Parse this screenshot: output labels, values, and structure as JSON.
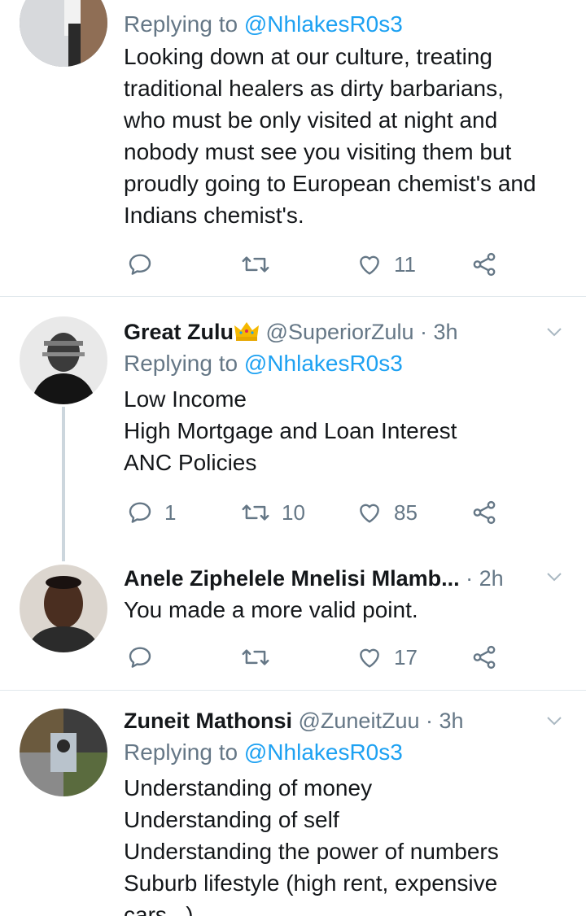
{
  "tweets": [
    {
      "reply_label": "Replying to",
      "reply_handle": "@NhlakesR0s3",
      "lines": [
        "Looking down at our culture, treating",
        "traditional healers as dirty barbarians,",
        "who must be only visited at night and",
        "nobody must see you visiting them but",
        "proudly going to European chemist's and",
        "Indians chemist's."
      ],
      "reply_count": "",
      "retweet_count": "",
      "like_count": "11"
    },
    {
      "name": "Great Zulu",
      "name_emoji": "👑",
      "handle": "@SuperiorZulu",
      "time": "· 3h",
      "reply_label": "Replying to",
      "reply_handle": "@NhlakesR0s3",
      "lines": [
        "Low Income",
        "High Mortgage and Loan Interest",
        "ANC Policies"
      ],
      "reply_count": "1",
      "retweet_count": "10",
      "like_count": "85"
    },
    {
      "name": "Anele Ziphelele Mnelisi Mlamb...",
      "handle": "",
      "time": "· 2h",
      "lines": [
        "You made a more valid point."
      ],
      "reply_count": "",
      "retweet_count": "",
      "like_count": "17"
    },
    {
      "name": "Zuneit Mathonsi",
      "handle": "@ZuneitZuu",
      "time": "· 3h",
      "reply_label": "Replying to",
      "reply_handle": "@NhlakesR0s3",
      "lines": [
        "Understanding of money",
        "Understanding of self",
        "Understanding the power of numbers",
        "Suburb lifestyle (high rent, expensive",
        "cars...)"
      ]
    }
  ],
  "colors": {
    "text": "#14171a",
    "secondary": "#657786",
    "link": "#1da1f2",
    "divider": "#e1e8ed",
    "thread": "#ccd6dd",
    "crown": "#f5b800"
  },
  "icons": [
    "reply-icon",
    "retweet-icon",
    "like-icon",
    "share-icon",
    "chevron-down-icon"
  ]
}
